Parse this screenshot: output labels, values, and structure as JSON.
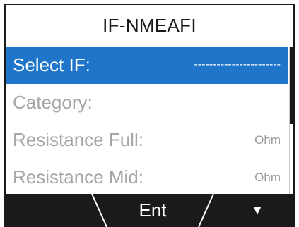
{
  "title": "IF-NMEAFI",
  "rows": [
    {
      "label": "Select IF:",
      "value": "-----------------------",
      "selected": true
    },
    {
      "label": "Category:",
      "value": "",
      "selected": false
    },
    {
      "label": "Resistance Full:",
      "value": "Ohm",
      "selected": false
    },
    {
      "label": "Resistance Mid:",
      "value": "Ohm",
      "selected": false
    }
  ],
  "softkeys": {
    "left": "",
    "middle": "Ent",
    "right_icon": "down-arrow-icon",
    "right_glyph": "▼"
  },
  "colors": {
    "selection": "#1f75c9",
    "dim_text": "#a6a6a6",
    "softkey_bar": "#1a1a1a"
  }
}
